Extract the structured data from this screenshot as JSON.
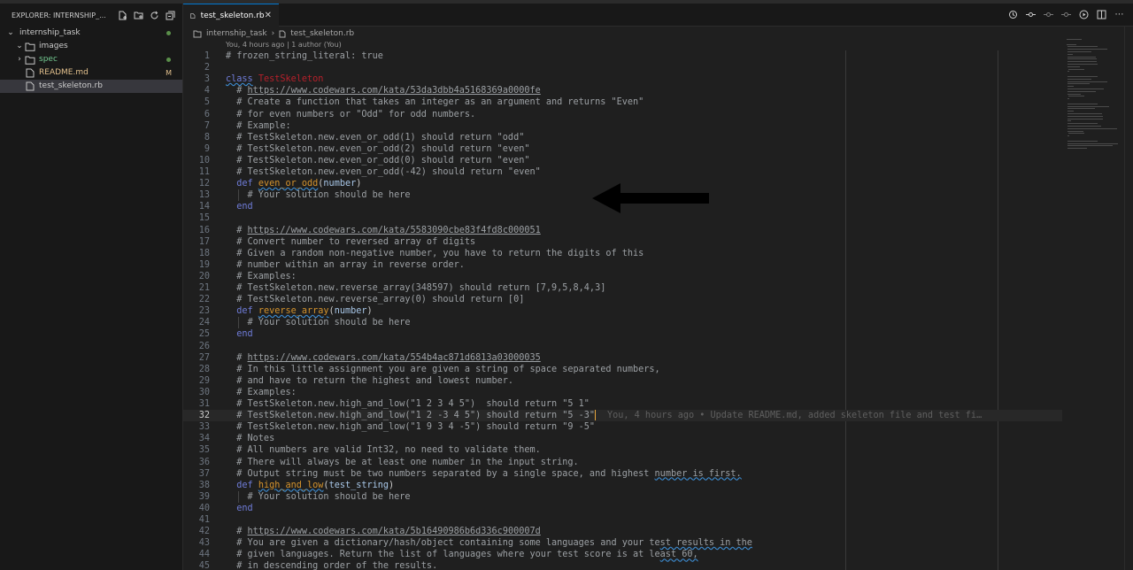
{
  "explorer": {
    "title": "EXPLORER: INTERNSHIP_...",
    "root": "internship_task",
    "items": [
      {
        "label": "images",
        "kind": "folder",
        "open": true,
        "color": "#cccccc",
        "badge": ""
      },
      {
        "label": "spec",
        "kind": "folder",
        "open": false,
        "color": "#73c991",
        "badge": "dot"
      },
      {
        "label": "README.md",
        "kind": "file-md",
        "color": "#e2c08d",
        "badge": "M"
      },
      {
        "label": "test_skeleton.rb",
        "kind": "file-rb",
        "color": "#cccccc",
        "badge": "",
        "active": true
      }
    ]
  },
  "tab": {
    "label": "test_skeleton.rb"
  },
  "breadcrumb": {
    "folder": "internship_task",
    "file": "test_skeleton.rb"
  },
  "blame_header": "You, 4 hours ago | 1 author (You)",
  "blame_inline": "You, 4 hours ago • Update README.md, added skeleton file and test fi…",
  "annotation": "arrow pointing left at line 13",
  "colors": {
    "accent": "#0078d4",
    "modified": "#e2c08d",
    "comment": "#9ca0a4",
    "keyword": "#6f7cd8",
    "class": "#b5202b",
    "method": "#d4932d"
  },
  "code": [
    {
      "n": "1",
      "segs": [
        [
          "cmt",
          "# frozen_string_literal: true"
        ]
      ]
    },
    {
      "n": "2",
      "segs": []
    },
    {
      "n": "3",
      "segs": [
        [
          "kw sq",
          "class"
        ],
        [
          "",
          " "
        ],
        [
          "cls",
          "TestSkeleton"
        ]
      ]
    },
    {
      "n": "4",
      "segs": [
        [
          "cmt",
          "  # "
        ],
        [
          "cmt lnk",
          "https://www.codewars.com/kata/53da3dbb4a5168369a0000fe"
        ]
      ]
    },
    {
      "n": "5",
      "segs": [
        [
          "cmt",
          "  # Create a function that takes an integer as an argument and returns \"Even\""
        ]
      ]
    },
    {
      "n": "6",
      "segs": [
        [
          "cmt",
          "  # for even numbers or \"Odd\" for odd numbers."
        ]
      ]
    },
    {
      "n": "7",
      "segs": [
        [
          "cmt",
          "  # Example:"
        ]
      ]
    },
    {
      "n": "8",
      "segs": [
        [
          "cmt",
          "  # TestSkeleton.new.even_or_odd(1) should return \"odd\""
        ]
      ]
    },
    {
      "n": "9",
      "segs": [
        [
          "cmt",
          "  # TestSkeleton.new.even_or_odd(2) should return \"even\""
        ]
      ]
    },
    {
      "n": "10",
      "segs": [
        [
          "cmt",
          "  # TestSkeleton.new.even_or_odd(0) should return \"even\""
        ]
      ]
    },
    {
      "n": "11",
      "segs": [
        [
          "cmt",
          "  # TestSkeleton.new.even_or_odd(-42) should return \"even\""
        ]
      ]
    },
    {
      "n": "12",
      "segs": [
        [
          "kw",
          "  def"
        ],
        [
          "",
          " "
        ],
        [
          "fn sq",
          "even_or_odd"
        ],
        [
          "",
          "("
        ],
        [
          "par",
          "number"
        ],
        [
          "",
          ")"
        ]
      ]
    },
    {
      "n": "13",
      "segs": [
        [
          "cmt",
          "    # Your solution should be here"
        ]
      ],
      "guide": true
    },
    {
      "n": "14",
      "segs": [
        [
          "kw",
          "  end"
        ]
      ]
    },
    {
      "n": "15",
      "segs": []
    },
    {
      "n": "16",
      "segs": [
        [
          "cmt",
          "  # "
        ],
        [
          "cmt lnk",
          "https://www.codewars.com/kata/5583090cbe83f4fd8c000051"
        ]
      ]
    },
    {
      "n": "17",
      "segs": [
        [
          "cmt",
          "  # Convert number to reversed array of digits"
        ]
      ]
    },
    {
      "n": "18",
      "segs": [
        [
          "cmt",
          "  # Given a random non-negative number, you have to return the digits of this"
        ]
      ]
    },
    {
      "n": "19",
      "segs": [
        [
          "cmt",
          "  # number within an array in reverse order."
        ]
      ]
    },
    {
      "n": "20",
      "segs": [
        [
          "cmt",
          "  # Examples:"
        ]
      ]
    },
    {
      "n": "21",
      "segs": [
        [
          "cmt",
          "  # TestSkeleton.new.reverse_array(348597) should return [7,9,5,8,4,3]"
        ]
      ]
    },
    {
      "n": "22",
      "segs": [
        [
          "cmt",
          "  # TestSkeleton.new.reverse_array(0) should return [0]"
        ]
      ]
    },
    {
      "n": "23",
      "segs": [
        [
          "kw",
          "  def"
        ],
        [
          "",
          " "
        ],
        [
          "fn sq",
          "reverse_array"
        ],
        [
          "",
          "("
        ],
        [
          "par",
          "number"
        ],
        [
          "",
          ")"
        ]
      ]
    },
    {
      "n": "24",
      "segs": [
        [
          "cmt",
          "    # Your solution should be here"
        ]
      ],
      "guide": true
    },
    {
      "n": "25",
      "segs": [
        [
          "kw",
          "  end"
        ]
      ]
    },
    {
      "n": "26",
      "segs": []
    },
    {
      "n": "27",
      "segs": [
        [
          "cmt",
          "  # "
        ],
        [
          "cmt lnk",
          "https://www.codewars.com/kata/554b4ac871d6813a03000035"
        ]
      ]
    },
    {
      "n": "28",
      "segs": [
        [
          "cmt",
          "  # In this little assignment you are given a string of space separated numbers,"
        ]
      ]
    },
    {
      "n": "29",
      "segs": [
        [
          "cmt",
          "  # and have to return the highest and lowest number."
        ]
      ]
    },
    {
      "n": "30",
      "segs": [
        [
          "cmt",
          "  # Examples:"
        ]
      ]
    },
    {
      "n": "31",
      "segs": [
        [
          "cmt",
          "  # TestSkeleton.new.high_and_low(\"1 2 3 4 5\")  should return \"5 1\""
        ]
      ]
    },
    {
      "n": "32",
      "segs": [
        [
          "cmt",
          "  # TestSkeleton.new.high_and_low(\"1 2 -3 4 5\") should return \"5 -3\""
        ]
      ],
      "current": true,
      "cursor": true,
      "blame": true
    },
    {
      "n": "33",
      "segs": [
        [
          "cmt",
          "  # TestSkeleton.new.high_and_low(\"1 9 3 4 -5\") should return \"9 -5\""
        ]
      ]
    },
    {
      "n": "34",
      "segs": [
        [
          "cmt",
          "  # Notes"
        ]
      ]
    },
    {
      "n": "35",
      "segs": [
        [
          "cmt",
          "  # All numbers are valid Int32, no need to validate them."
        ]
      ]
    },
    {
      "n": "36",
      "segs": [
        [
          "cmt",
          "  # There will always be at least one number in the input string."
        ]
      ]
    },
    {
      "n": "37",
      "segs": [
        [
          "cmt",
          "  # Output string must be two numbers separated by a single space, and highest "
        ],
        [
          "cmt sq",
          "number is first."
        ]
      ]
    },
    {
      "n": "38",
      "segs": [
        [
          "kw",
          "  def"
        ],
        [
          "",
          " "
        ],
        [
          "fn sq",
          "high_and_low"
        ],
        [
          "",
          "("
        ],
        [
          "par",
          "test_string"
        ],
        [
          "",
          ")"
        ]
      ]
    },
    {
      "n": "39",
      "segs": [
        [
          "cmt",
          "    # Your solution should be here"
        ]
      ],
      "guide": true
    },
    {
      "n": "40",
      "segs": [
        [
          "kw",
          "  end"
        ]
      ]
    },
    {
      "n": "41",
      "segs": []
    },
    {
      "n": "42",
      "segs": [
        [
          "cmt",
          "  # "
        ],
        [
          "cmt lnk",
          "https://www.codewars.com/kata/5b16490986b6d336c900007d"
        ]
      ]
    },
    {
      "n": "43",
      "segs": [
        [
          "cmt",
          "  # You are given a dictionary/hash/object containing some languages and your te"
        ],
        [
          "cmt sq",
          "st results in the"
        ]
      ]
    },
    {
      "n": "44",
      "segs": [
        [
          "cmt",
          "  # given languages. Return the list of languages where your test score is at le"
        ],
        [
          "cmt sq",
          "ast 60,"
        ]
      ]
    },
    {
      "n": "45",
      "segs": [
        [
          "cmt",
          "  # in descending order of the results."
        ]
      ]
    }
  ]
}
